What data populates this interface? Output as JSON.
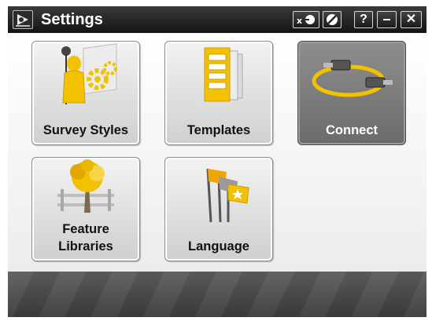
{
  "window": {
    "title": "Settings",
    "icon": "app-menu-icon",
    "buttons": [
      {
        "name": "keyboard-toggle-button",
        "icon": "keyboard-icon"
      },
      {
        "name": "backlight-button",
        "icon": "backlight-icon"
      },
      {
        "name": "help-button",
        "label": "?"
      },
      {
        "name": "minimize-button",
        "label": "–"
      },
      {
        "name": "close-button",
        "label": "✕"
      }
    ]
  },
  "tiles": [
    {
      "id": "survey-styles",
      "label": "Survey Styles",
      "icon": "survey-styles-icon",
      "selected": false
    },
    {
      "id": "templates",
      "label": "Templates",
      "icon": "templates-icon",
      "selected": false
    },
    {
      "id": "connect",
      "label": "Connect",
      "icon": "connect-cable-icon",
      "selected": true
    },
    {
      "id": "feature-libraries",
      "label_line1": "Feature",
      "label_line2": "Libraries",
      "icon": "feature-libraries-icon",
      "selected": false
    },
    {
      "id": "language",
      "label": "Language",
      "icon": "language-flags-icon",
      "selected": false
    }
  ],
  "colors": {
    "titlebar": "#1c1c1c",
    "accent_yellow": "#f2c200",
    "tile_selected": "#7a7a7a",
    "content_background": "#f5f5f5",
    "bottom_bar": "#4a4a4a"
  }
}
